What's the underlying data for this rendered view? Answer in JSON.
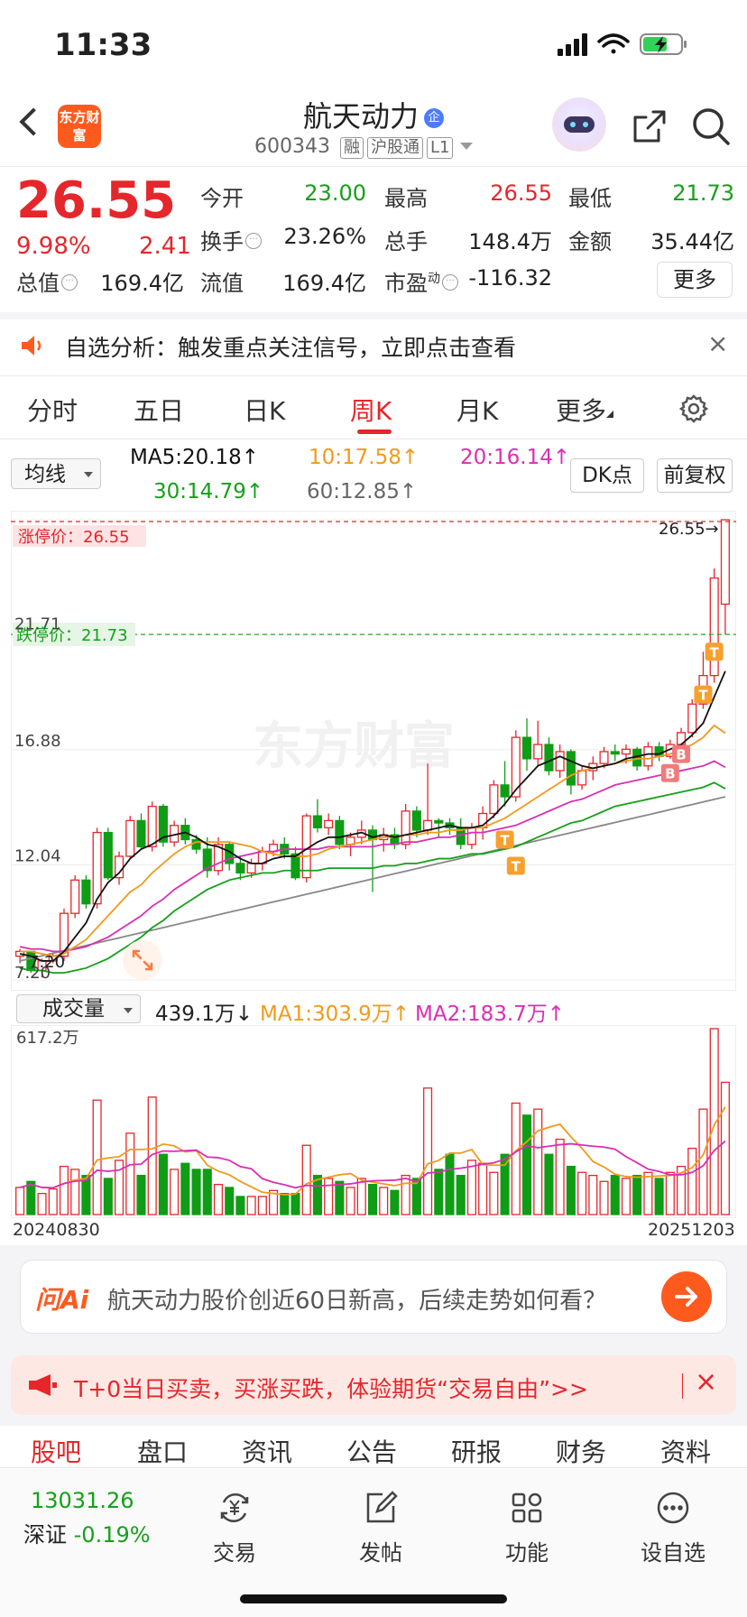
{
  "status_bar": {
    "time": "11:33"
  },
  "header": {
    "logo_text": "东方财富",
    "stock_name": "航天动力",
    "qi_badge": "企",
    "code": "600343",
    "tags": [
      "融",
      "沪股通",
      "L1"
    ]
  },
  "quote": {
    "price": "26.55",
    "change_pct": "9.98%",
    "change": "2.41",
    "fields": [
      {
        "label": "今开",
        "value": "23.00",
        "color": "#16a01a"
      },
      {
        "label": "最高",
        "value": "26.55",
        "color": "#e5262b"
      },
      {
        "label": "最低",
        "value": "21.73",
        "color": "#16a01a"
      },
      {
        "label": "换手",
        "value": "23.26%",
        "color": "#222"
      },
      {
        "label": "总手",
        "value": "148.4万",
        "color": "#222"
      },
      {
        "label": "金额",
        "value": "35.44亿",
        "color": "#222"
      },
      {
        "label": "总值",
        "value": "169.4亿",
        "color": "#222"
      },
      {
        "label": "流值",
        "value": "169.4亿",
        "color": "#222"
      },
      {
        "label": "市盈",
        "value": "-116.32",
        "color": "#222"
      }
    ],
    "pe_sup": "动",
    "more_button": "更多"
  },
  "alert": {
    "text": "自选分析：触发重点关注信号，立即点击查看",
    "close": "×"
  },
  "tabs": {
    "items": [
      "分时",
      "五日",
      "日K",
      "周K",
      "月K",
      "更多"
    ],
    "active_index": 3
  },
  "ma_bar": {
    "selector": "均线",
    "ma5": "MA5:20.18↑",
    "ma10": "10:17.58↑",
    "ma20": "20:16.14↑",
    "ma30": "30:14.79↑",
    "ma60": "60:12.85↑",
    "dk_button": "DK点",
    "adjust_button": "前复权"
  },
  "kline": {
    "limit_up_label": "涨停价：26.55",
    "limit_down_label": "跌停价：21.73",
    "axis_labels": [
      "26.55",
      "21.71",
      "16.88",
      "12.04",
      "7.20"
    ],
    "last_price_marker": "26.55→",
    "low_marker": "7.20",
    "watermark": "东方财富"
  },
  "volume_bar": {
    "selector": "成交量",
    "current": "439.1万↓",
    "ma1": "MA1:303.9万↑",
    "ma2": "MA2:183.7万↑",
    "axis_max": "617.2万"
  },
  "dates": {
    "start": "20240830",
    "end": "20251203"
  },
  "ai": {
    "logo": "问Ai",
    "prompt": "航天动力股价创近60日新高，后续走势如何看？"
  },
  "promo": {
    "text": "T+0当日买卖，买涨买跌，体验期货“交易自由”>>",
    "close": "×"
  },
  "sub_tabs": [
    "股吧",
    "盘口",
    "资讯",
    "公告",
    "研报",
    "财务",
    "资料"
  ],
  "bottom_bar": {
    "index_value": "13031.26",
    "index_name": "深证",
    "index_change": "-0.19%",
    "items": [
      {
        "label": "交易",
        "icon": "trade-icon"
      },
      {
        "label": "发帖",
        "icon": "compose-icon"
      },
      {
        "label": "功能",
        "icon": "grid-icon"
      },
      {
        "label": "设自选",
        "icon": "more-icon"
      }
    ]
  },
  "chart_data": {
    "type": "candlestick",
    "period": "weekly",
    "y_range": [
      7.2,
      26.55
    ],
    "y_ticks": [
      26.55,
      21.71,
      16.88,
      12.04,
      7.2
    ],
    "candles": [
      [
        8.2,
        8.5,
        7.9,
        8.4
      ],
      [
        8.4,
        8.4,
        7.5,
        7.6
      ],
      [
        7.6,
        8.1,
        7.3,
        8.0
      ],
      [
        8.0,
        8.3,
        7.9,
        8.2
      ],
      [
        8.2,
        10.2,
        8.0,
        10.0
      ],
      [
        10.0,
        11.6,
        9.8,
        11.4
      ],
      [
        11.4,
        11.6,
        10.2,
        10.4
      ],
      [
        10.4,
        13.6,
        10.2,
        13.4
      ],
      [
        13.4,
        13.6,
        11.4,
        11.5
      ],
      [
        11.5,
        12.6,
        11.2,
        12.4
      ],
      [
        12.4,
        14.1,
        12.3,
        13.9
      ],
      [
        13.9,
        14.2,
        12.7,
        12.8
      ],
      [
        12.8,
        14.7,
        12.6,
        14.5
      ],
      [
        14.5,
        14.6,
        12.8,
        13.0
      ],
      [
        13.0,
        13.9,
        12.8,
        13.7
      ],
      [
        13.7,
        14.0,
        12.9,
        13.1
      ],
      [
        13.1,
        13.3,
        12.5,
        12.7
      ],
      [
        12.7,
        13.2,
        11.5,
        11.8
      ],
      [
        11.8,
        13.2,
        11.6,
        12.9
      ],
      [
        12.9,
        13.0,
        11.8,
        12.1
      ],
      [
        12.1,
        12.4,
        11.4,
        11.7
      ],
      [
        11.7,
        12.3,
        11.5,
        12.1
      ],
      [
        12.1,
        12.8,
        11.8,
        12.6
      ],
      [
        12.6,
        13.1,
        12.4,
        12.9
      ],
      [
        12.9,
        13.2,
        12.3,
        12.5
      ],
      [
        12.5,
        12.8,
        11.4,
        11.5
      ],
      [
        11.5,
        14.2,
        11.3,
        14.1
      ],
      [
        14.1,
        14.8,
        13.4,
        13.6
      ],
      [
        13.6,
        14.2,
        13.3,
        13.9
      ],
      [
        13.9,
        14.1,
        12.7,
        12.9
      ],
      [
        12.9,
        13.4,
        12.4,
        13.2
      ],
      [
        13.2,
        13.9,
        12.9,
        13.5
      ],
      [
        13.5,
        13.7,
        10.9,
        13.1
      ],
      [
        13.1,
        13.6,
        12.6,
        13.3
      ],
      [
        13.3,
        13.6,
        12.7,
        12.9
      ],
      [
        12.9,
        14.6,
        12.7,
        14.3
      ],
      [
        14.3,
        14.5,
        13.2,
        13.5
      ],
      [
        13.5,
        16.3,
        13.3,
        13.9
      ],
      [
        13.9,
        14.0,
        13.2,
        13.8
      ],
      [
        13.8,
        14.0,
        13.3,
        13.6
      ],
      [
        13.6,
        14.0,
        12.7,
        12.9
      ],
      [
        12.9,
        13.8,
        12.7,
        13.6
      ],
      [
        13.6,
        14.5,
        13.1,
        14.2
      ],
      [
        14.2,
        15.6,
        14.0,
        15.4
      ],
      [
        15.4,
        16.4,
        14.5,
        14.9
      ],
      [
        14.9,
        17.7,
        14.7,
        17.4
      ],
      [
        17.4,
        18.2,
        16.0,
        16.5
      ],
      [
        16.5,
        18.1,
        16.2,
        17.1
      ],
      [
        17.1,
        17.4,
        15.8,
        16.0
      ],
      [
        16.0,
        17.1,
        15.7,
        16.8
      ],
      [
        16.8,
        16.9,
        15.0,
        15.4
      ],
      [
        15.4,
        16.2,
        15.2,
        16.0
      ],
      [
        16.0,
        16.6,
        15.6,
        16.3
      ],
      [
        16.3,
        17.0,
        16.1,
        16.8
      ],
      [
        16.8,
        17.1,
        16.4,
        16.7
      ],
      [
        16.7,
        17.1,
        16.3,
        16.9
      ],
      [
        16.9,
        17.0,
        16.0,
        16.2
      ],
      [
        16.2,
        17.2,
        16.0,
        17.0
      ],
      [
        17.0,
        17.2,
        16.4,
        16.6
      ],
      [
        16.6,
        17.3,
        16.5,
        17.1
      ],
      [
        17.1,
        17.8,
        16.7,
        17.6
      ],
      [
        17.6,
        19.0,
        17.4,
        18.8
      ],
      [
        18.8,
        21.0,
        18.6,
        20.0
      ],
      [
        20.0,
        24.5,
        19.7,
        24.1
      ],
      [
        23.0,
        26.55,
        21.73,
        26.55
      ]
    ],
    "ma5": [
      8.3,
      8.2,
      8.0,
      8.0,
      8.4,
      9.0,
      9.6,
      10.6,
      11.3,
      11.7,
      12.3,
      12.7,
      12.9,
      13.2,
      13.3,
      13.4,
      13.2,
      12.9,
      12.8,
      12.6,
      12.3,
      12.1,
      12.1,
      12.3,
      12.4,
      12.4,
      12.7,
      13.0,
      13.2,
      13.2,
      13.3,
      13.4,
      13.2,
      13.3,
      13.2,
      13.3,
      13.4,
      13.5,
      13.6,
      13.7,
      13.6,
      13.6,
      13.7,
      14.1,
      14.6,
      15.2,
      15.7,
      16.2,
      16.4,
      16.6,
      16.4,
      16.2,
      16.1,
      16.2,
      16.3,
      16.5,
      16.6,
      16.7,
      16.7,
      16.9,
      17.1,
      17.5,
      18.0,
      19.1,
      20.18
    ],
    "ma10": [
      8.4,
      8.4,
      8.3,
      8.2,
      8.3,
      8.6,
      8.9,
      9.4,
      9.9,
      10.4,
      10.9,
      11.2,
      11.7,
      12.1,
      12.5,
      12.8,
      13.0,
      13.0,
      13.0,
      13.0,
      12.9,
      12.8,
      12.6,
      12.5,
      12.4,
      12.4,
      12.4,
      12.5,
      12.7,
      12.8,
      12.9,
      13.0,
      13.1,
      13.2,
      13.2,
      13.3,
      13.3,
      13.4,
      13.4,
      13.5,
      13.5,
      13.6,
      13.6,
      13.8,
      14.0,
      14.3,
      14.6,
      14.9,
      15.2,
      15.5,
      15.8,
      16.0,
      16.1,
      16.2,
      16.3,
      16.4,
      16.5,
      16.5,
      16.6,
      16.7,
      16.9,
      17.1,
      17.4,
      17.9,
      17.58
    ],
    "ma20": [
      8.6,
      8.5,
      8.5,
      8.4,
      8.4,
      8.5,
      8.6,
      8.8,
      9.0,
      9.3,
      9.6,
      9.9,
      10.3,
      10.6,
      11.0,
      11.3,
      11.6,
      11.9,
      12.1,
      12.3,
      12.4,
      12.5,
      12.6,
      12.6,
      12.7,
      12.7,
      12.7,
      12.7,
      12.8,
      12.8,
      12.8,
      12.8,
      12.8,
      12.9,
      12.9,
      13.0,
      13.0,
      13.1,
      13.2,
      13.2,
      13.3,
      13.4,
      13.4,
      13.5,
      13.6,
      13.7,
      13.9,
      14.1,
      14.3,
      14.5,
      14.7,
      14.8,
      15.0,
      15.2,
      15.4,
      15.5,
      15.6,
      15.7,
      15.8,
      15.9,
      16.0,
      16.1,
      16.2,
      16.4,
      16.14
    ]
  }
}
